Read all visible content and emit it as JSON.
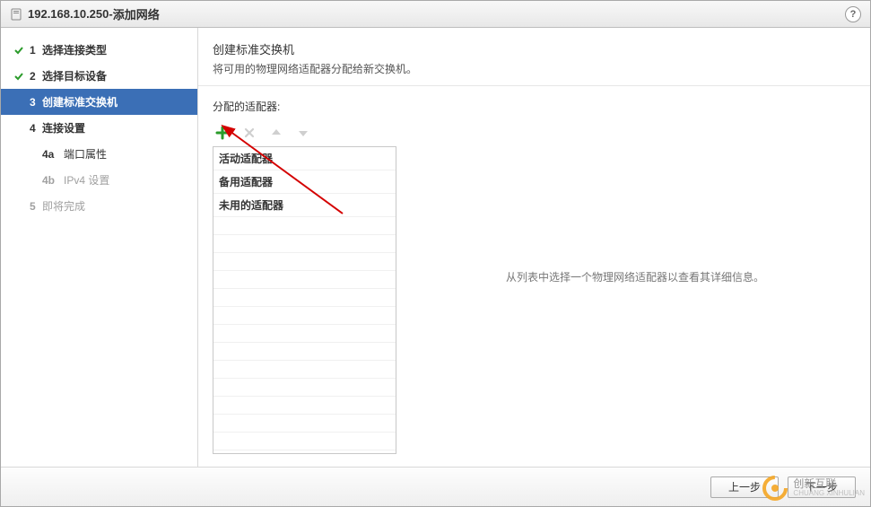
{
  "title": {
    "host": "192.168.10.250",
    "sep": " - ",
    "label": "添加网络"
  },
  "sidebar": {
    "steps": [
      {
        "num": "1",
        "label": "选择连接类型"
      },
      {
        "num": "2",
        "label": "选择目标设备"
      },
      {
        "num": "3",
        "label": "创建标准交换机"
      },
      {
        "num": "4",
        "label": "连接设置"
      },
      {
        "num": "4a",
        "label": "端口属性"
      },
      {
        "num": "4b",
        "label": "IPv4 设置"
      },
      {
        "num": "5",
        "label": "即将完成"
      }
    ]
  },
  "content": {
    "header_title": "创建标准交换机",
    "header_sub": "将可用的物理网络适配器分配给新交换机。",
    "assigned_label": "分配的适配器:",
    "groups": {
      "active": "活动适配器",
      "standby": "备用适配器",
      "unused": "未用的适配器"
    },
    "detail_hint": "从列表中选择一个物理网络适配器以查看其详细信息。"
  },
  "footer": {
    "back": "上一步",
    "next": "下一步"
  },
  "watermark": {
    "main": "创新互联",
    "sub": "CHUANG XINHULIAN"
  },
  "icons": {
    "add": "add-icon",
    "remove": "remove-icon",
    "up": "arrow-up-icon",
    "down": "arrow-down-icon",
    "help": "?"
  },
  "colors": {
    "primary": "#3b6fb6",
    "success": "#2a9b2a",
    "add": "#2a9b2a",
    "annotation": "#d40000"
  }
}
